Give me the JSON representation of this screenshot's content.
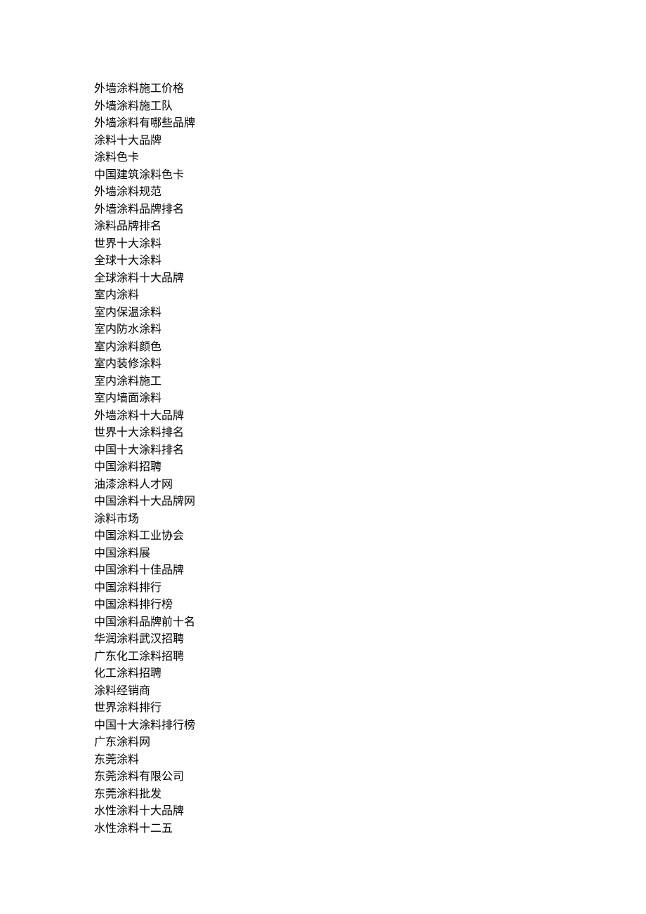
{
  "lines": [
    "外墙涂料施工价格",
    "外墙涂料施工队",
    "外墙涂料有哪些品牌",
    "涂料十大品牌",
    "涂料色卡",
    "中国建筑涂料色卡",
    "外墙涂料规范",
    "外墙涂料品牌排名",
    "涂料品牌排名",
    "世界十大涂料",
    "全球十大涂料",
    "全球涂料十大品牌",
    "室内涂料",
    "室内保温涂料",
    "室内防水涂料",
    "室内涂料颜色",
    "室内装修涂料",
    "室内涂料施工",
    "室内墙面涂料",
    "外墙涂料十大品牌",
    "世界十大涂料排名",
    "中国十大涂料排名",
    "中国涂料招聘",
    "油漆涂料人才网",
    "中国涂料十大品牌网",
    "涂料市场",
    "中国涂料工业协会",
    "中国涂料展",
    "中国涂料十佳品牌",
    "中国涂料排行",
    "中国涂料排行榜",
    "中国涂料品牌前十名",
    "华润涂料武汉招聘",
    "广东化工涂料招聘",
    "化工涂料招聘",
    "涂料经销商",
    "世界涂料排行",
    "中国十大涂料排行榜",
    "广东涂料网",
    "东莞涂料",
    "东莞涂料有限公司",
    "东莞涂料批发",
    "水性涂料十大品牌",
    "水性涂料十二五"
  ]
}
